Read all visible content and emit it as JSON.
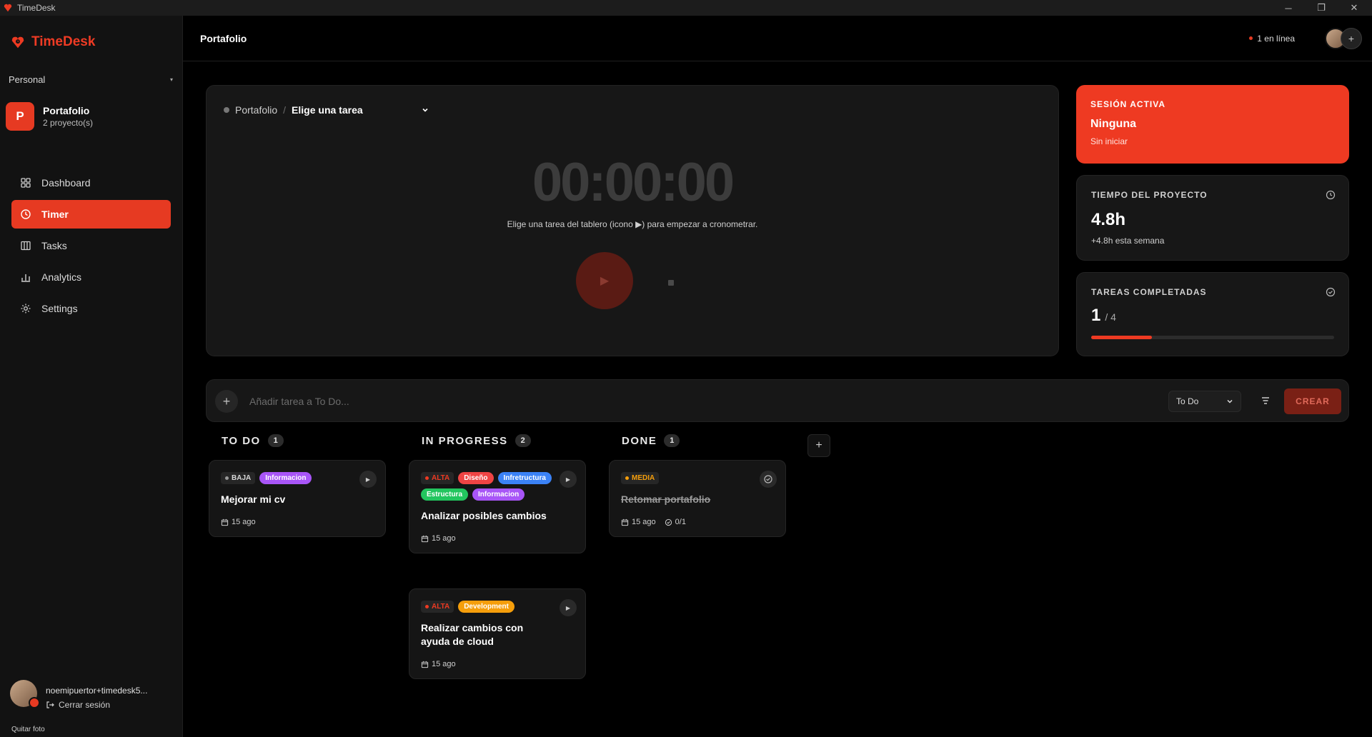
{
  "app": {
    "title": "TimeDesk",
    "brand": "TimeDesk"
  },
  "window": {
    "minimize": "─",
    "maximize": "❐",
    "close": "✕"
  },
  "sidebar": {
    "workspace": "Personal",
    "project": {
      "initial": "P",
      "name": "Portafolio",
      "sub": "2 proyecto(s)"
    },
    "items": [
      {
        "label": "Dashboard",
        "icon": "dashboard-icon"
      },
      {
        "label": "Timer",
        "icon": "clock-icon",
        "active": true
      },
      {
        "label": "Tasks",
        "icon": "columns-icon"
      },
      {
        "label": "Analytics",
        "icon": "bar-chart-icon"
      },
      {
        "label": "Settings",
        "icon": "gear-icon"
      }
    ],
    "user": {
      "email": "noemipuertor+timedesk5...",
      "logout": "Cerrar sesión",
      "remove_photo": "Quitar foto"
    }
  },
  "header": {
    "title": "Portafolio",
    "online": "1 en línea",
    "add": "+"
  },
  "timer": {
    "project": "Portafolio",
    "separator": "/",
    "task_placeholder": "Elige una tarea",
    "time": "00:00:00",
    "hint": "Elige una tarea del tablero (icono ▶) para empezar a cronometrar."
  },
  "stats": {
    "session": {
      "label": "SESIÓN ACTIVA",
      "value": "Ninguna",
      "sub": "Sin iniciar"
    },
    "project_time": {
      "label": "TIEMPO DEL PROYECTO",
      "value": "4.8h",
      "sub": "+4.8h esta semana"
    },
    "completed": {
      "label": "TAREAS COMPLETADAS",
      "done": "1",
      "total": "/ 4",
      "progress": 0.25
    }
  },
  "add_task": {
    "placeholder": "Añadir tarea a To Do...",
    "column": "To Do",
    "create": "CREAR"
  },
  "board": {
    "columns": [
      {
        "name": "TO DO",
        "count": "1"
      },
      {
        "name": "IN PROGRESS",
        "count": "2"
      },
      {
        "name": "DONE",
        "count": "1"
      }
    ],
    "cards": [
      {
        "priority": "BAJA",
        "tags": [
          "Informacion"
        ],
        "title": "Mejorar mi cv",
        "date": "15 ago"
      },
      {
        "priority": "ALTA",
        "tags": [
          "Diseño",
          "Infretructura",
          "Estructura",
          "Informacion"
        ],
        "title": "Analizar posibles cambios",
        "date": "15 ago"
      },
      {
        "priority": "ALTA",
        "tags": [
          "Development"
        ],
        "title": "Realizar cambios con ayuda de cloud",
        "date": "15 ago"
      },
      {
        "priority": "MEDIA",
        "tags": [],
        "title": "Retomar portafolio",
        "date": "15 ago",
        "subtasks": "0/1"
      }
    ]
  },
  "colors": {
    "accent": "#ee3a22",
    "priority_low": "#9a9a9a",
    "priority_high": "#ee3a22",
    "priority_medium": "#f59e0b",
    "tag_purple": "#a855f7",
    "tag_red": "#ef4444",
    "tag_blue": "#3b82f6",
    "tag_green": "#22c55e",
    "tag_orange": "#f59e0b"
  }
}
